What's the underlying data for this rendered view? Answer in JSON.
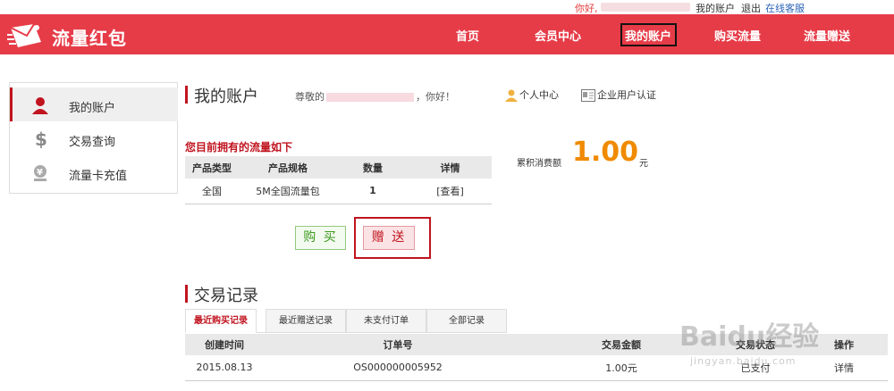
{
  "topbar": {
    "greeting": "你好,",
    "my_account": "我的账户",
    "logout": "退出",
    "online_service": "在线客服"
  },
  "header": {
    "logo_text": "流量红包",
    "nav": [
      "首页",
      "会员中心",
      "我的账户",
      "购买流量",
      "流量赠送"
    ],
    "active_nav": "我的账户"
  },
  "sidebar": {
    "items": [
      {
        "label": "我的账户",
        "icon": "user-icon"
      },
      {
        "label": "交易查询",
        "icon": "dollar-icon"
      },
      {
        "label": "流量卡充值",
        "icon": "yen-card-icon"
      }
    ]
  },
  "account": {
    "title": "我的账户",
    "greeting_prefix": "尊敬的",
    "greeting_suffix": "，你好！",
    "personal_center": "个人中心",
    "enterprise_auth": "企业用户认证"
  },
  "traffic": {
    "heading": "您目前拥有的流量如下",
    "columns": [
      "产品类型",
      "产品规格",
      "数量",
      "详情"
    ],
    "rows": [
      {
        "type": "全国",
        "spec": "5M全国流量包",
        "qty": "1",
        "detail": "[查看]"
      }
    ],
    "buy_label": "购 买",
    "gift_label": "赠 送"
  },
  "spending": {
    "label": "累积消费额",
    "value": "1.00",
    "unit": "元"
  },
  "records": {
    "title": "交易记录",
    "tabs": [
      "最近购买记录",
      "最近赠送记录",
      "未支付订单",
      "全部记录"
    ],
    "active_tab": 0,
    "columns": [
      "创建时间",
      "订单号",
      "交易金额",
      "交易状态",
      "操作"
    ],
    "rows": [
      {
        "time": "2015.08.13",
        "order": "OS000000005952",
        "amount": "1.00元",
        "status": "已支付",
        "action": "详情"
      }
    ]
  },
  "watermark": {
    "text": "Baidu经验",
    "url": "jingyan.baidu.com"
  },
  "colors": {
    "brand_red": "#e63c48",
    "accent_red": "#c0141f",
    "amount_orange": "#f08a00",
    "link_blue": "#2a63b7"
  }
}
